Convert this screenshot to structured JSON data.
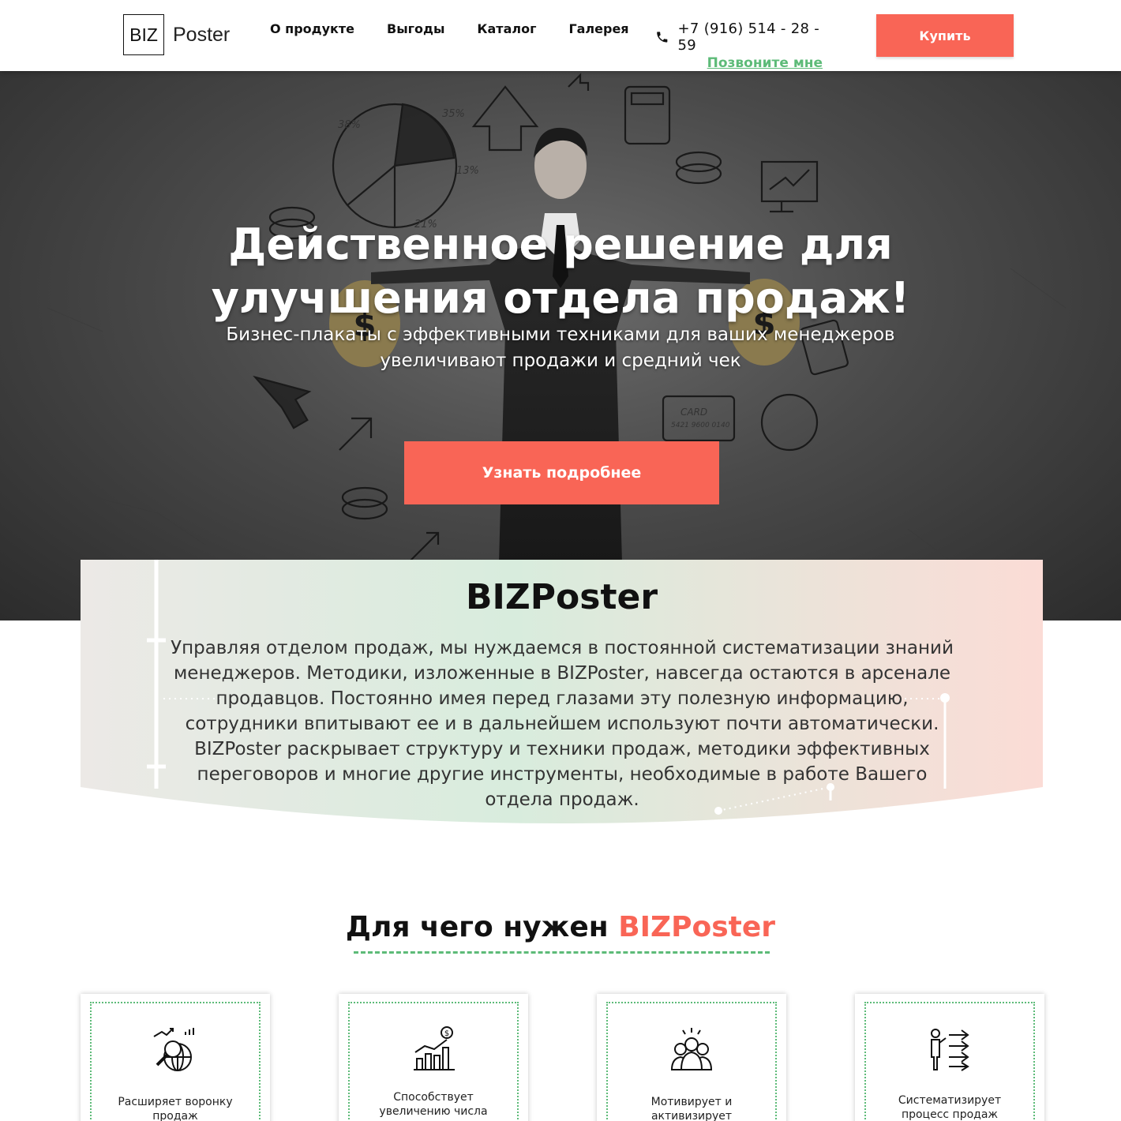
{
  "header": {
    "logo_box": "BIZ",
    "logo_text": "Poster",
    "nav": [
      "О продукте",
      "Выгоды",
      "Каталог",
      "Галерея"
    ],
    "phone": "+7 (916) 514 - 28 - 59",
    "callback": "Позвоните мне",
    "buy": "Купить"
  },
  "hero": {
    "title_line1": "Действенное решение для",
    "title_line2": "улучшения отдела продаж!",
    "subtitle_line1": "Бизнес-плакаты с эффективными техниками для ваших менеджеров",
    "subtitle_line2": "увеличивают продажи и средний чек",
    "cta": "Узнать подробнее",
    "doodles": [
      "38%",
      "35%",
      "13%",
      "21%",
      "CARD",
      "5421 9600 0140"
    ]
  },
  "about": {
    "title": "BIZPoster",
    "text": "Управляя отделом продаж, мы нуждаемся в постоянной систематизации знаний менеджеров. Методики, изложенные в BIZPoster, навсегда остаются в арсенале продавцов. Постоянно имея перед глазами эту полезную информацию, сотрудники впитывают ее и в дальнейшем используют почти автоматически. BIZPoster раскрывает структуру и техники продаж, методики эффективных переговоров и многие другие инструменты, необходимые в работе Вашего отдела продаж."
  },
  "why": {
    "title_prefix": "Для чего нужен ",
    "title_accent": "BIZPoster",
    "cards": [
      {
        "icon": "funnel-growth-icon",
        "line1": "Расширяет воронку",
        "line2": "продаж"
      },
      {
        "icon": "sales-chart-icon",
        "line1": "Способствует",
        "line2": "увеличению числа"
      },
      {
        "icon": "team-motivation-icon",
        "line1": "Мотивирует и",
        "line2": "активизирует"
      },
      {
        "icon": "process-arrows-icon",
        "line1": "Систематизирует",
        "line2": "процесс продаж"
      }
    ]
  },
  "colors": {
    "accent": "#f96556",
    "green": "#5dbb78"
  }
}
